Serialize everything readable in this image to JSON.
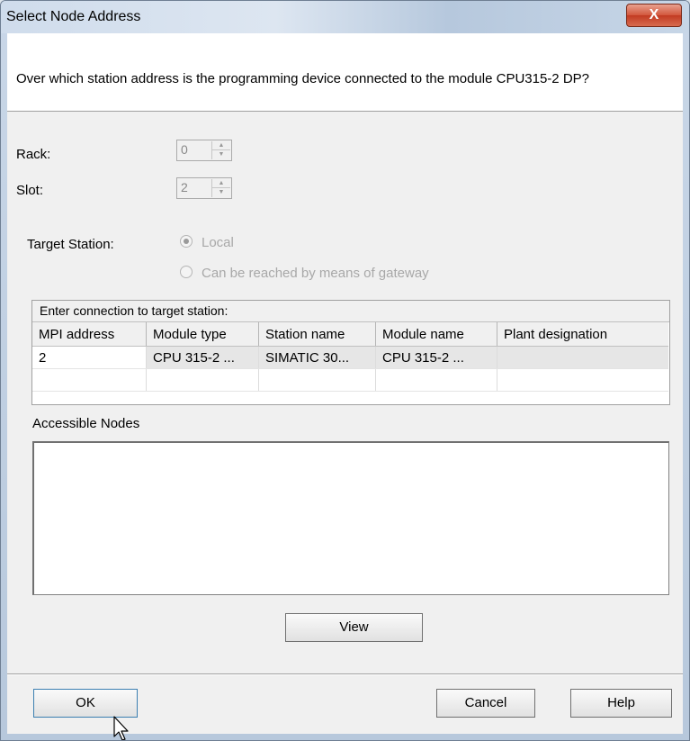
{
  "window": {
    "title": "Select Node Address",
    "close_label": "X"
  },
  "prompt": "Over which station address is the programming device connected to the module CPU315-2 DP?",
  "rack": {
    "label": "Rack:",
    "value": "0"
  },
  "slot": {
    "label": "Slot:",
    "value": "2"
  },
  "target_station": {
    "label": "Target Station:",
    "options": [
      "Local",
      "Can be reached by means of gateway"
    ],
    "selected": "Local"
  },
  "connection": {
    "caption": "Enter connection to target station:",
    "columns": [
      "MPI address",
      "Module type",
      "Station name",
      "Module name",
      "Plant designation"
    ],
    "rows": [
      [
        "2",
        "CPU 315-2 ...",
        "SIMATIC 30...",
        "CPU 315-2 ...",
        ""
      ],
      [
        "",
        "",
        "",
        "",
        ""
      ]
    ]
  },
  "accessible_nodes": {
    "label": "Accessible Nodes"
  },
  "buttons": {
    "view": "View",
    "ok": "OK",
    "cancel": "Cancel",
    "help": "Help"
  }
}
